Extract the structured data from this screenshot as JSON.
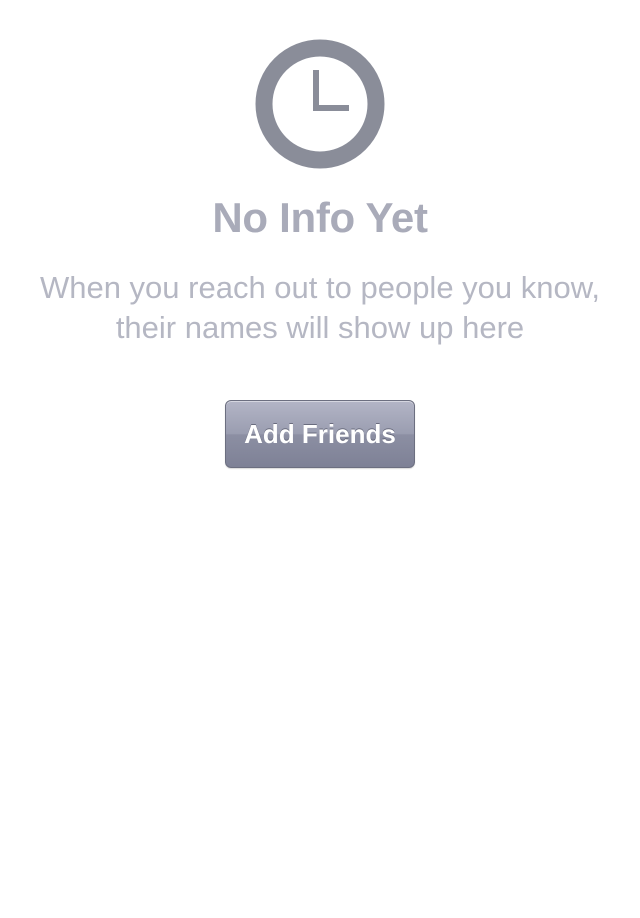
{
  "empty_state": {
    "icon": "clock-icon",
    "title": "No Info Yet",
    "message": "When you reach out to people you know, their names will show up here",
    "button_label": "Add Friends"
  },
  "colors": {
    "icon": "#8a8d99",
    "title": "#a9abb9",
    "message": "#b5b7c3",
    "button_top": "#b3b5c6",
    "button_bottom": "#7e8196",
    "button_text": "#ffffff"
  }
}
